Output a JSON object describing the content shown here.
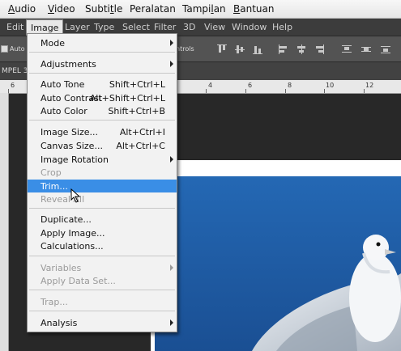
{
  "video_menubar": [
    {
      "label": "Audio"
    },
    {
      "label": "Video"
    },
    {
      "label": "Subtitle"
    },
    {
      "label": "Peralatan"
    },
    {
      "label": "Tampilan"
    },
    {
      "label": "Bantuan"
    }
  ],
  "ps_menubar": [
    "Edit",
    "Image",
    "Layer",
    "Type",
    "Select",
    "Filter",
    "3D",
    "View",
    "Window",
    "Help"
  ],
  "options_bar": {
    "auto_label": "Auto",
    "controls_label": "ntrols"
  },
  "doc_tab": {
    "title": "MPEL 3."
  },
  "ruler": {
    "ticks": [
      "6",
      "4",
      "6",
      "8",
      "10",
      "12"
    ]
  },
  "image_menu": {
    "items": [
      {
        "label": "Mode",
        "shortcut": "",
        "submenu": true,
        "enabled": true
      },
      {
        "label": "Adjustments",
        "shortcut": "",
        "submenu": true,
        "enabled": true
      },
      {
        "label": "Auto Tone",
        "shortcut": "Shift+Ctrl+L",
        "submenu": false,
        "enabled": true
      },
      {
        "label": "Auto Contrast",
        "shortcut": "Alt+Shift+Ctrl+L",
        "submenu": false,
        "enabled": true
      },
      {
        "label": "Auto Color",
        "shortcut": "Shift+Ctrl+B",
        "submenu": false,
        "enabled": true
      },
      {
        "label": "Image Size...",
        "shortcut": "Alt+Ctrl+I",
        "submenu": false,
        "enabled": true
      },
      {
        "label": "Canvas Size...",
        "shortcut": "Alt+Ctrl+C",
        "submenu": false,
        "enabled": true
      },
      {
        "label": "Image Rotation",
        "shortcut": "",
        "submenu": true,
        "enabled": true
      },
      {
        "label": "Crop",
        "shortcut": "",
        "submenu": false,
        "enabled": false
      },
      {
        "label": "Trim...",
        "shortcut": "",
        "submenu": false,
        "enabled": true,
        "highlighted": true
      },
      {
        "label": "Reveal All",
        "shortcut": "",
        "submenu": false,
        "enabled": false
      },
      {
        "label": "Duplicate...",
        "shortcut": "",
        "submenu": false,
        "enabled": true
      },
      {
        "label": "Apply Image...",
        "shortcut": "",
        "submenu": false,
        "enabled": true
      },
      {
        "label": "Calculations...",
        "shortcut": "",
        "submenu": false,
        "enabled": true
      },
      {
        "label": "Variables",
        "shortcut": "",
        "submenu": true,
        "enabled": false
      },
      {
        "label": "Apply Data Set...",
        "shortcut": "",
        "submenu": false,
        "enabled": false
      },
      {
        "label": "Trap...",
        "shortcut": "",
        "submenu": false,
        "enabled": false
      },
      {
        "label": "Analysis",
        "shortcut": "",
        "submenu": true,
        "enabled": true
      }
    ]
  },
  "colors": {
    "highlight": "#3a8ee6",
    "sky": "#1f5da8",
    "menu_bg": "#f2f2f2"
  }
}
